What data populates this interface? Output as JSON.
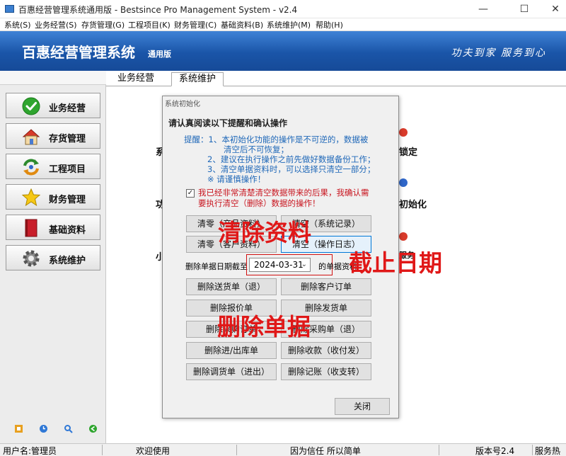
{
  "window": {
    "title": "百惠经营管理系统通用版 - Bestsince Pro Management System - v2.4",
    "controls": {
      "minimize": "—",
      "maximize": "☐",
      "close": "✕"
    }
  },
  "menu": [
    "系统(S)",
    "业务经营(S)",
    "存货管理(G)",
    "工程项目(K)",
    "财务管理(C)",
    "基础资料(B)",
    "系统维护(M)",
    "帮助(H)"
  ],
  "banner": {
    "brand": "百惠经营管理系统",
    "brand_sub": "通用版",
    "slogan": "功夫到家 服务到心"
  },
  "sidebar": [
    {
      "label": "业务经营",
      "icon": "green-check-icon"
    },
    {
      "label": "存货管理",
      "icon": "house-icon"
    },
    {
      "label": "工程项目",
      "icon": "cycle-arrows-icon"
    },
    {
      "label": "财务管理",
      "icon": "star-icon"
    },
    {
      "label": "基础资料",
      "icon": "book-icon"
    },
    {
      "label": "系统维护",
      "icon": "gear-icon"
    }
  ],
  "tabs": [
    "业务经营",
    "系统维护"
  ],
  "background": {
    "frag1": "系",
    "frag2": "锁定",
    "frag3": "功",
    "frag4": "初始化",
    "frag5": "小",
    "frag6": "服务"
  },
  "dialog": {
    "title": "系统初始化",
    "heading": "请认真阅读以下提醒和确认操作",
    "notice": [
      "提醒：1、本初始化功能的操作是不可逆的，数据被",
      "         清空后不可恢复；",
      "     2、建议在执行操作之前先做好数据备份工作；",
      "     3、清空单据资料时，可以选择只清空一部分；",
      "     ※  请谨慎操作！"
    ],
    "confirm_checked": "✓",
    "confirm_text": [
      "我已经非常清楚清空数据带来的后果，我确认需",
      "要执行清空（删除）数据的操作！"
    ],
    "buttons": {
      "clear_product": "清零（产品资料）",
      "clear_log": "清空（系统记录）",
      "clear_customer": "清零（客户资料）",
      "clear_oplog": "清空（操作日志）"
    },
    "date_label": "删除单据日期截至",
    "date_value": "2024-03-31",
    "date_suffix": "的单据资料",
    "delete_buttons": [
      "删除送货单（退）",
      "删除客户订单",
      "删除报价单",
      "删除发货单",
      "删除采购订单",
      "删除采购单（退）",
      "删除进/出库单",
      "删除收款（收付发）",
      "删除调货单（进出）",
      "删除记账（收支转）"
    ],
    "close": "关闭"
  },
  "annotations": {
    "clear_data": "清除资料",
    "cutoff_date": "截止日期",
    "delete_docs": "删除单据"
  },
  "status": {
    "user": "用户名:管理员",
    "welcome": "欢迎使用",
    "motto": "因为信任 所以简单",
    "version": "版本号2.4",
    "service": "服务热"
  }
}
